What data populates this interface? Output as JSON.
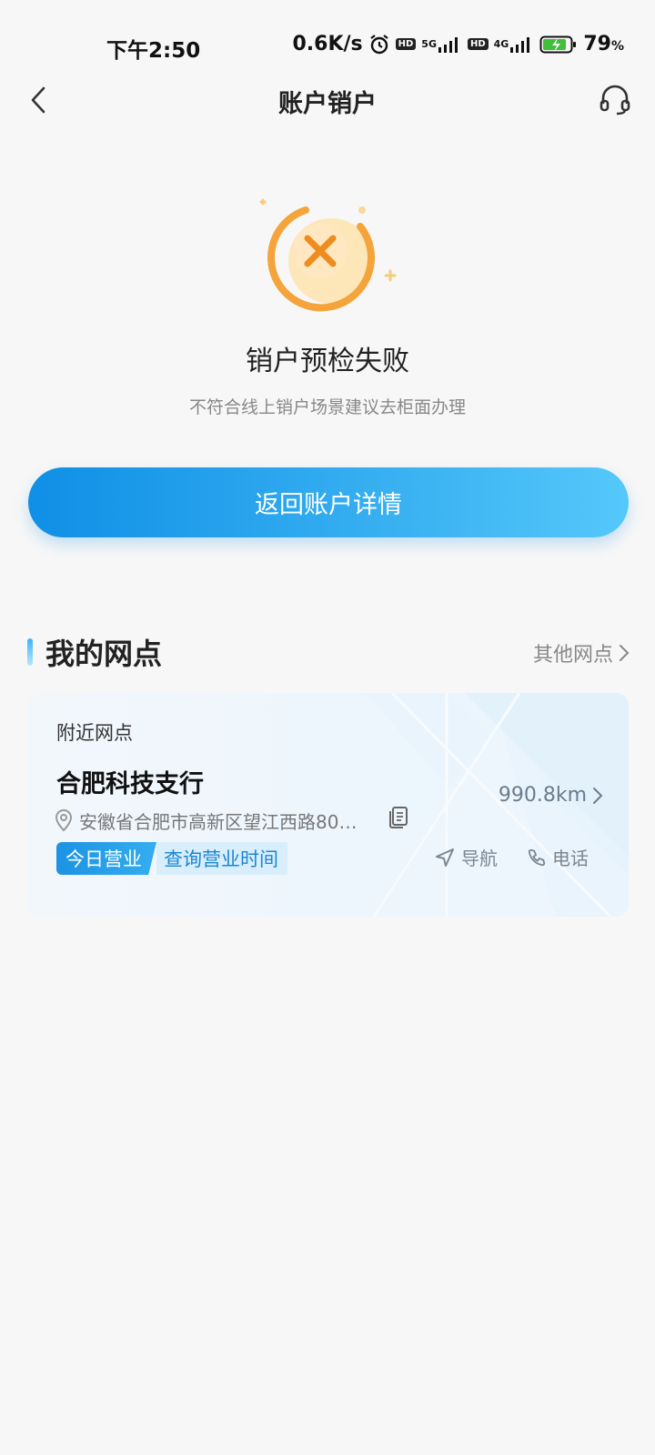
{
  "status_bar": {
    "time": "下午2:50",
    "speed": "0.6K/s",
    "hd_badge": "HD",
    "net1": "5G",
    "net2": "4G",
    "battery": "79",
    "battery_unit": "%"
  },
  "header": {
    "title": "账户销户"
  },
  "result": {
    "title": "销户预检失败",
    "description": "不符合线上销户场景建议去柜面办理",
    "button_label": "返回账户详情"
  },
  "branch_section": {
    "title": "我的网点",
    "more_label": "其他网点",
    "card": {
      "subtitle": "附近网点",
      "name": "合肥科技支行",
      "address": "安徽省合肥市高新区望江西路80…",
      "distance": "990.8km",
      "open_tag": "今日营业",
      "hours_link": "查询营业时间",
      "nav_label": "导航",
      "call_label": "电话"
    }
  },
  "colors": {
    "primary": "#1a96e8",
    "accent_orange": "#f5a020",
    "background": "#f7f7f7"
  },
  "icons": {
    "back": "chevron-left-icon",
    "service": "headset-icon",
    "location": "location-pin-icon",
    "copy": "copy-icon",
    "navigate": "navigation-arrow-icon",
    "phone": "phone-icon"
  }
}
